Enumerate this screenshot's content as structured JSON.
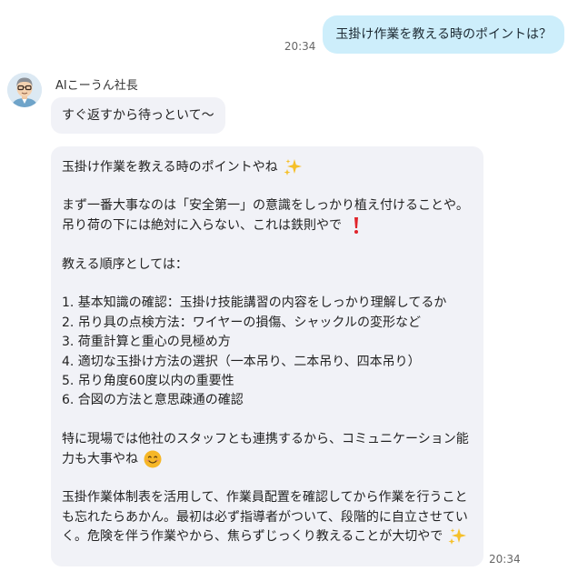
{
  "user_message": {
    "text": "玉掛け作業を教える時のポイントは？",
    "time": "20:34"
  },
  "bot": {
    "name": "AIこーうん社長",
    "avatar": "avatar-man-with-glasses",
    "quick_reply": "すぐ返すから待っといて〜",
    "reply": {
      "lines": [
        "玉掛け作業を教える時のポイントやね",
        "",
        "まず一番大事なのは「安全第一」の意識をしっかり植え付けることや。",
        "吊り荷の下には絶対に入らない、これは鉄則やで",
        "",
        "教える順序としては：",
        "",
        "1. 基本知識の確認：玉掛け技能講習の内容をしっかり理解してるか",
        "2. 吊り具の点検方法：ワイヤーの損傷、シャックルの変形など",
        "3. 荷重計算と重心の見極め方",
        "4. 適切な玉掛け方法の選択（一本吊り、二本吊り、四本吊り）",
        "5. 吊り角度60度以内の重要性",
        "6. 合図の方法と意思疎通の確認",
        "",
        "特に現場では他社のスタッフとも連携するから、コミュニケーション能",
        "力も大事やね",
        "",
        "玉掛作業体制表を活用して、作業員配置を確認してから作業を行うこと",
        "も忘れたらあかん。最初は必ず指導者がついて、段階的に自立させてい",
        "く。危険を伴う作業やから、焦らずじっくり教えることが大切やで"
      ],
      "emojis": {
        "line_0": "sparkles-emoji",
        "line_3": "exclamation-emoji",
        "line_15": "smiling-face-emoji",
        "line_19": "sparkles-emoji"
      },
      "time": "20:34"
    }
  },
  "colors": {
    "user_bubble": "#cdeefb",
    "bot_bubble": "#f1f2f7",
    "timestamp": "#666666",
    "sparkles": "#f5c02a",
    "exclamation": "#e0242b",
    "smile": "#f6b727"
  }
}
